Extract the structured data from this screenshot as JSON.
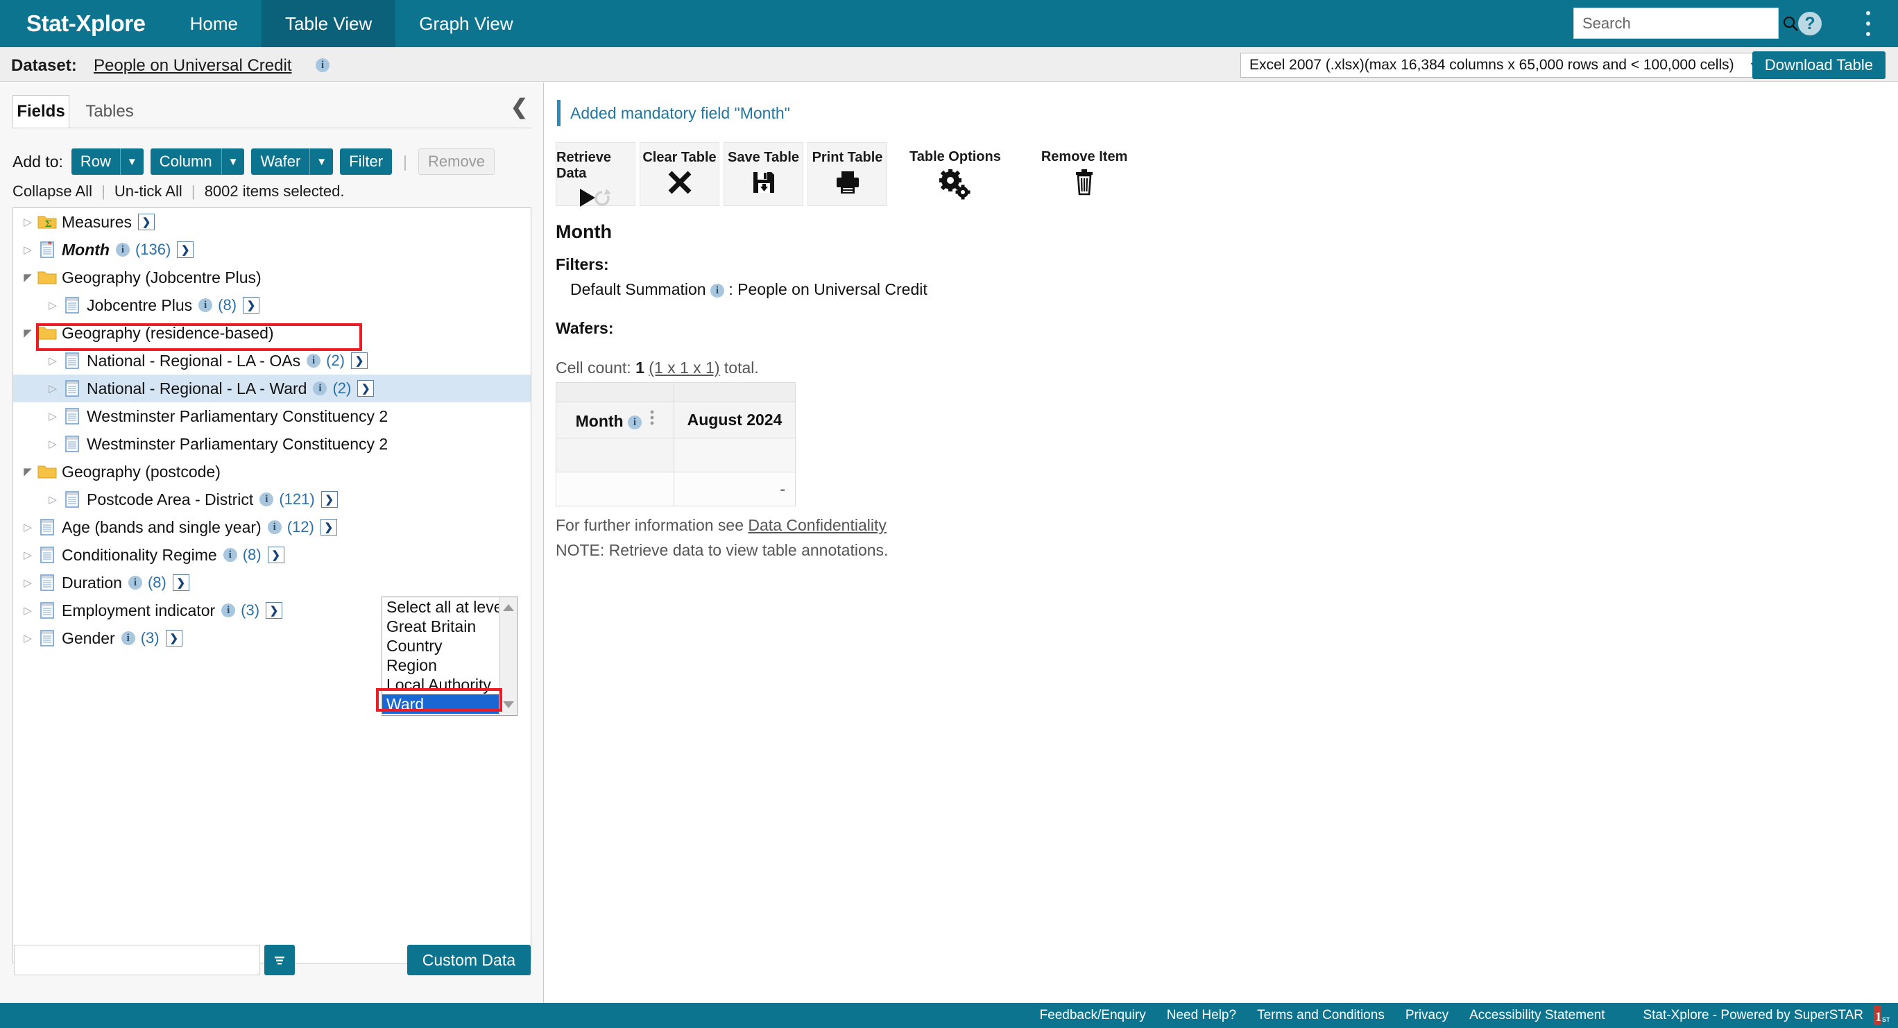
{
  "header": {
    "brand": "Stat-Xplore",
    "nav": [
      {
        "label": "Home",
        "active": false
      },
      {
        "label": "Table View",
        "active": true
      },
      {
        "label": "Graph View",
        "active": false
      }
    ],
    "search_placeholder": "Search",
    "help_glyph": "?",
    "accent": "#0d7490"
  },
  "dataset_bar": {
    "label": "Dataset:",
    "name": "People on Universal Credit",
    "format_value": "Excel 2007 (.xlsx)(max 16,384 columns x 65,000 rows and < 100,000 cells)",
    "download_label": "Download Table"
  },
  "left_panel": {
    "tabs": [
      {
        "label": "Fields",
        "active": true
      },
      {
        "label": "Tables",
        "active": false
      }
    ],
    "add_to_label": "Add to:",
    "buttons": [
      {
        "label": "Row",
        "has_caret": true
      },
      {
        "label": "Column",
        "has_caret": true
      },
      {
        "label": "Wafer",
        "has_caret": true
      },
      {
        "label": "Filter",
        "has_caret": false
      }
    ],
    "remove_label": "Remove",
    "meta": {
      "collapse_all": "Collapse All",
      "untick_all": "Un-tick All",
      "selected": "8002 items selected."
    },
    "tree": [
      {
        "indent": 0,
        "twisty": "closed",
        "icon": "measures-folder-icon",
        "label": "Measures",
        "info": false,
        "count": null,
        "go": true,
        "style": "normal"
      },
      {
        "indent": 0,
        "twisty": "closed",
        "icon": "mandatory-field-icon",
        "label": "Month",
        "info": true,
        "count": "(136)",
        "go": true,
        "style": "bold-italic"
      },
      {
        "indent": 0,
        "twisty": "open",
        "icon": "folder-icon",
        "label": "Geography (Jobcentre Plus)",
        "info": false,
        "count": null,
        "go": false,
        "style": "normal"
      },
      {
        "indent": 1,
        "twisty": "closed",
        "icon": "field-icon",
        "label": "Jobcentre Plus",
        "info": true,
        "count": "(8)",
        "go": true,
        "style": "normal"
      },
      {
        "indent": 0,
        "twisty": "open",
        "icon": "folder-icon",
        "label": "Geography (residence-based)",
        "info": false,
        "count": null,
        "go": false,
        "style": "normal"
      },
      {
        "indent": 1,
        "twisty": "closed",
        "icon": "field-icon",
        "label": "National - Regional - LA - OAs",
        "info": true,
        "count": "(2)",
        "go": true,
        "style": "normal"
      },
      {
        "indent": 1,
        "twisty": "closed",
        "icon": "field-icon",
        "label": "National - Regional - LA - Ward",
        "info": true,
        "count": "(2)",
        "go": true,
        "style": "normal",
        "selected": true,
        "highlighted": true
      },
      {
        "indent": 1,
        "twisty": "closed",
        "icon": "field-icon",
        "label": "Westminster Parliamentary Constituency 2",
        "info": false,
        "count": null,
        "go": false,
        "style": "normal"
      },
      {
        "indent": 1,
        "twisty": "closed",
        "icon": "field-icon",
        "label": "Westminster Parliamentary Constituency 2",
        "info": false,
        "count": null,
        "go": false,
        "style": "normal"
      },
      {
        "indent": 0,
        "twisty": "open",
        "icon": "folder-icon",
        "label": "Geography (postcode)",
        "info": false,
        "count": null,
        "go": false,
        "style": "normal"
      },
      {
        "indent": 1,
        "twisty": "closed",
        "icon": "field-icon",
        "label": "Postcode Area - District",
        "info": true,
        "count": "(121)",
        "go": true,
        "style": "normal"
      },
      {
        "indent": 0,
        "twisty": "closed",
        "icon": "field-icon",
        "label": "Age (bands and single year)",
        "info": true,
        "count": "(12)",
        "go": true,
        "style": "normal"
      },
      {
        "indent": 0,
        "twisty": "closed",
        "icon": "field-icon",
        "label": "Conditionality Regime",
        "info": true,
        "count": "(8)",
        "go": true,
        "style": "normal"
      },
      {
        "indent": 0,
        "twisty": "closed",
        "icon": "field-icon",
        "label": "Duration",
        "info": true,
        "count": "(8)",
        "go": true,
        "style": "normal"
      },
      {
        "indent": 0,
        "twisty": "closed",
        "icon": "field-icon",
        "label": "Employment indicator",
        "info": true,
        "count": "(3)",
        "go": true,
        "style": "normal"
      },
      {
        "indent": 0,
        "twisty": "closed",
        "icon": "field-icon",
        "label": "Gender",
        "info": true,
        "count": "(3)",
        "go": true,
        "style": "normal"
      }
    ],
    "level_dropdown": {
      "options": [
        {
          "label": "Select all at level",
          "selected": false
        },
        {
          "label": "Great Britain",
          "selected": false
        },
        {
          "label": "Country",
          "selected": false
        },
        {
          "label": "Region",
          "selected": false
        },
        {
          "label": "Local Authority",
          "selected": false
        },
        {
          "label": "Ward",
          "selected": true
        }
      ]
    },
    "filter_input_value": "",
    "custom_data_label": "Custom Data",
    "highlight_color": "#ee1c25"
  },
  "content": {
    "notice": "Added mandatory field \"Month\"",
    "toolbar": [
      {
        "label": "Retrieve Data",
        "icon": "play-refresh-icon",
        "boxed": true
      },
      {
        "label": "Clear Table",
        "icon": "cross-icon",
        "boxed": true
      },
      {
        "label": "Save Table",
        "icon": "floppy-save-icon",
        "boxed": true
      },
      {
        "label": "Print Table",
        "icon": "printer-icon",
        "boxed": true
      },
      {
        "label": "Table Options",
        "icon": "gears-icon",
        "boxed": false
      },
      {
        "label": "Remove Item",
        "icon": "trash-icon",
        "boxed": false
      }
    ],
    "section_title": "Month",
    "filters_heading": "Filters:",
    "filter_item_label": "Default Summation",
    "filter_item_value": ": People on Universal Credit",
    "wafers_heading": "Wafers:",
    "cell_count_prefix": "Cell count: ",
    "cell_count_value": "1",
    "cell_count_dims": "(1 x 1 x 1)",
    "cell_count_suffix": " total.",
    "table": {
      "row_header_label": "Month",
      "column_header": "August 2024",
      "cell_value": "-"
    },
    "info_line_1_prefix": "For further information see ",
    "info_line_1_link": "Data Confidentiality",
    "info_line_2": "NOTE: Retrieve data to view table annotations."
  },
  "footer": {
    "links": [
      "Feedback/Enquiry",
      "Need Help?",
      "Terms and Conditions",
      "Privacy",
      "Accessibility Statement"
    ],
    "powered": "Stat-Xplore - Powered by SuperSTAR"
  }
}
